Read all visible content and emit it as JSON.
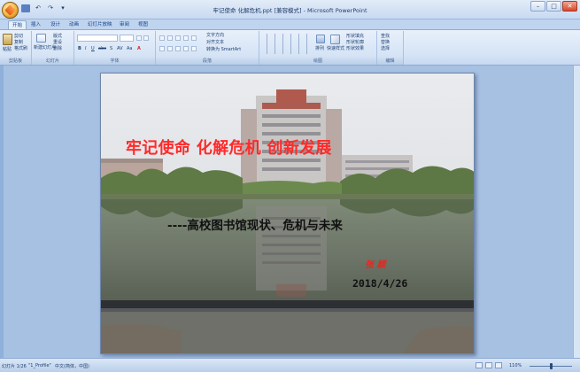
{
  "window": {
    "title": "牢记使命 化解危机.ppt [兼容模式] - Microsoft PowerPoint",
    "controls": [
      "–",
      "□",
      "✕"
    ]
  },
  "tabs": [
    {
      "label": "开始",
      "active": true
    },
    {
      "label": "插入",
      "active": false
    },
    {
      "label": "设计",
      "active": false
    },
    {
      "label": "动画",
      "active": false
    },
    {
      "label": "幻灯片放映",
      "active": false
    },
    {
      "label": "审阅",
      "active": false
    },
    {
      "label": "视图",
      "active": false
    }
  ],
  "ribbon": {
    "clipboard": {
      "label": "剪贴板",
      "paste": "粘贴",
      "cut": "剪切",
      "copy": "复制",
      "format_painter": "格式刷"
    },
    "slides": {
      "label": "幻灯片",
      "new_slide": "新建幻灯片",
      "layout": "版式",
      "reset": "重设",
      "delete": "删除"
    },
    "font": {
      "label": "字体"
    },
    "paragraph": {
      "label": "段落",
      "text_direction": "文字方向",
      "align_text": "对齐文本",
      "smartart": "转换为 SmartArt"
    },
    "drawing": {
      "label": "绘图",
      "arrange": "排列",
      "quick_styles": "快速样式",
      "shape_fill": "形状填充",
      "shape_outline": "形状轮廓",
      "shape_effects": "形状效果"
    },
    "editing": {
      "label": "编辑",
      "find": "查找",
      "replace": "替换",
      "select": "选择"
    }
  },
  "slide": {
    "title": "牢记使命 化解危机 创新发展",
    "subtitle": "----高校图书馆现状、危机与未来",
    "author": "张 颖",
    "date": "2018/4/26"
  },
  "status": {
    "slide_indicator": "幻灯片 1/26",
    "theme": "\"1_Profile\"",
    "language": "中文(简体，中国)",
    "zoom": "110%"
  }
}
